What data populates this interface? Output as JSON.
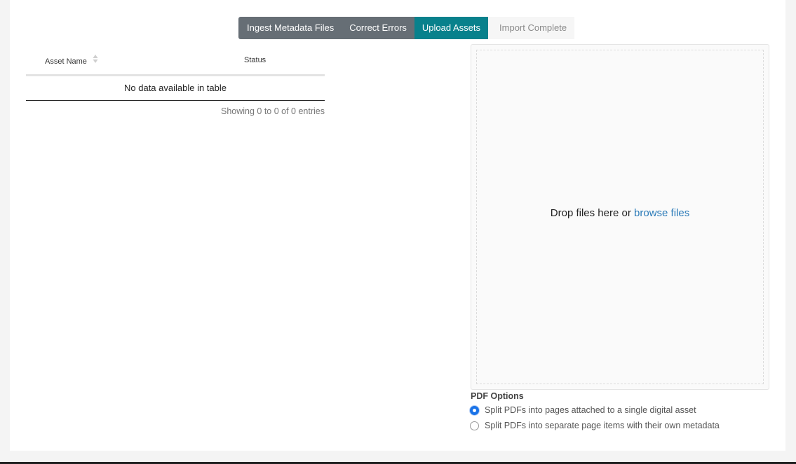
{
  "steps": [
    {
      "label": "Ingest Metadata Files",
      "state": "done"
    },
    {
      "label": "Correct Errors",
      "state": "done"
    },
    {
      "label": "Upload Assets",
      "state": "active"
    },
    {
      "label": "Import Complete",
      "state": "pending"
    }
  ],
  "table": {
    "columns": [
      "Asset Name",
      "Status"
    ],
    "empty_message": "No data available in table",
    "info": "Showing 0 to 0 of 0 entries"
  },
  "dropzone": {
    "text": "Drop files here or",
    "link": "browse files"
  },
  "pdf_options": {
    "title": "PDF Options",
    "options": [
      {
        "label": "Split PDFs into pages attached to a single digital asset",
        "checked": true
      },
      {
        "label": "Split PDFs into separate page items with their own metadata",
        "checked": false
      }
    ]
  },
  "colors": {
    "step_done": "#666e75",
    "step_active": "#08818c",
    "link": "#2a7ab8",
    "radio_checked": "#1a73e8"
  }
}
